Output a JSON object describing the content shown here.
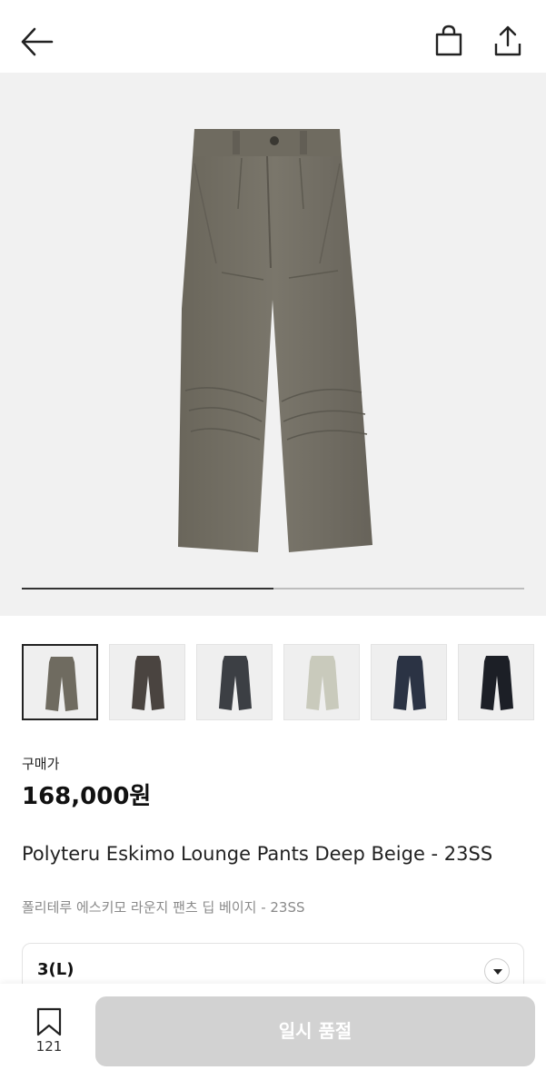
{
  "header": {
    "back_icon": "arrow-left-icon",
    "bag_icon": "shopping-bag-icon",
    "share_icon": "share-upload-icon"
  },
  "gallery": {
    "main_image": "olive-khaki pleated wide-leg pants",
    "progress": 0.5,
    "thumbnails": [
      {
        "color": "#6f6b60",
        "selected": true
      },
      {
        "color": "#4a4440",
        "selected": false
      },
      {
        "color": "#3c3f44",
        "selected": false
      },
      {
        "color": "#c9cabc",
        "selected": false
      },
      {
        "color": "#2b3344",
        "selected": false
      },
      {
        "color": "#1c1f26",
        "selected": false
      }
    ]
  },
  "product": {
    "price_label": "구매가",
    "price": "168,000원",
    "title_en": "Polyteru Eskimo Lounge Pants Deep Beige - 23SS",
    "title_ko": "폴리테루 에스키모 라운지 팬츠 딥 베이지 - 23SS"
  },
  "option": {
    "selected_value": "3(L)",
    "arrow_icon": "caret-down-icon"
  },
  "bottom": {
    "bookmark_icon": "bookmark-icon",
    "bookmark_count": "121",
    "soldout_label": "일시 품절"
  },
  "colors": {
    "accent_disabled": "#d2d2d2",
    "hero_bg": "#f1f1f1",
    "pants_main": "#736f64"
  }
}
